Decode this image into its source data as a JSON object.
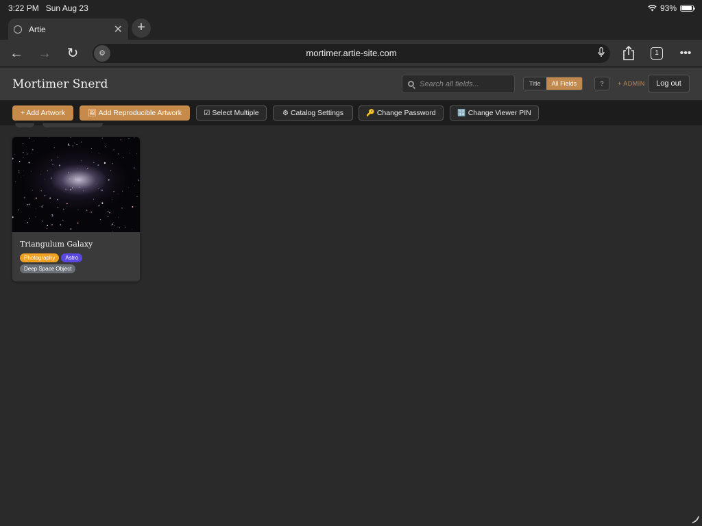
{
  "status_bar": {
    "time": "3:22 PM",
    "date": "Sun Aug 23",
    "battery": "93%",
    "battery_level": 0.93
  },
  "browser": {
    "tab_title": "Artie",
    "url": "mortimer.artie-site.com",
    "tab_count": "1"
  },
  "header": {
    "brand": "Mortimer Snerd",
    "search_placeholder": "Search all fields...",
    "search_modes": [
      "Title",
      "All Fields"
    ],
    "active_search_mode": "All Fields",
    "help_label": "?",
    "admin_label": "+ ADMIN",
    "logout_label": "Log out"
  },
  "actions": {
    "add_artwork": "+ Add Artwork",
    "add_reproducible": "Add Reproducible Artwork",
    "select_multiple": "Select Multiple",
    "catalog_settings": "Catalog Settings",
    "change_password": "Change Password",
    "change_viewer_pin": "Change Viewer PIN"
  },
  "artworks": [
    {
      "title": "Triangulum Galaxy",
      "tags": [
        {
          "label": "Photography",
          "color": "#f0a020"
        },
        {
          "label": "Astro",
          "color": "#5a48e0"
        },
        {
          "label": "Deep Space Object",
          "color": "#6b6f78"
        }
      ]
    }
  ],
  "colors": {
    "accent": "#c68b4b",
    "background": "#2a2a2a"
  }
}
